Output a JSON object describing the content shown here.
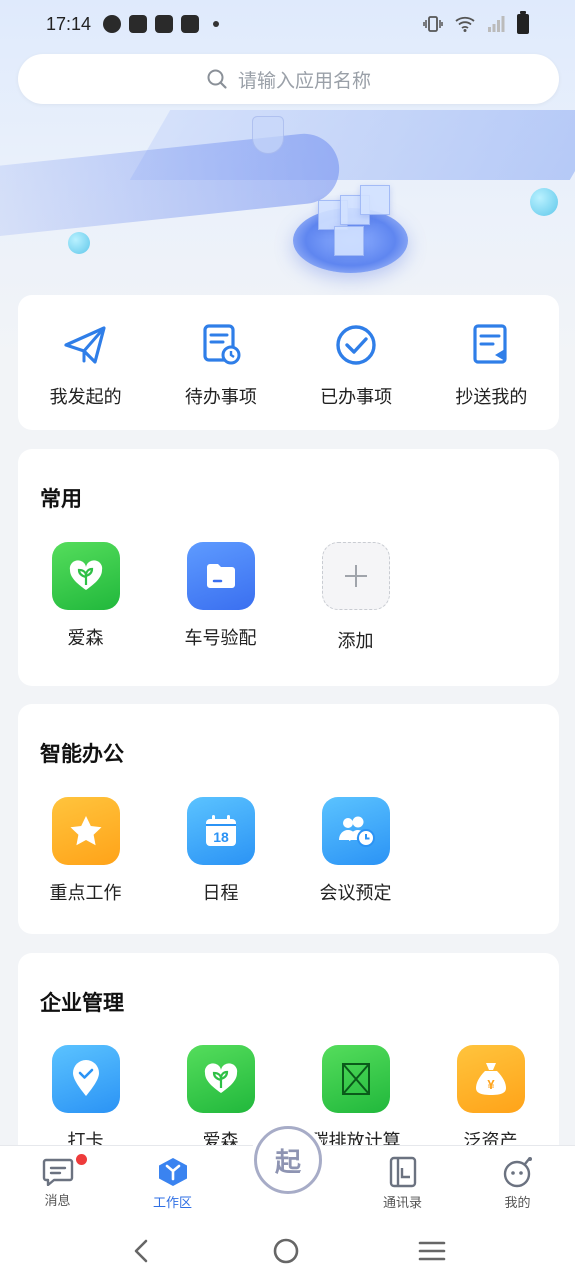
{
  "status_bar": {
    "time": "17:14"
  },
  "search": {
    "placeholder": "请输入应用名称"
  },
  "quick_actions": [
    {
      "label": "我发起的",
      "icon": "paper-plane-icon"
    },
    {
      "label": "待办事项",
      "icon": "todo-list-icon"
    },
    {
      "label": "已办事项",
      "icon": "check-circle-icon"
    },
    {
      "label": "抄送我的",
      "icon": "cc-document-icon"
    }
  ],
  "sections": {
    "common": {
      "title": "常用",
      "apps": [
        {
          "label": "爱森",
          "icon": "heart-leaf-icon"
        },
        {
          "label": "车号验配",
          "icon": "folder-icon"
        },
        {
          "label": "添加",
          "icon": "plus-icon"
        }
      ]
    },
    "smart_office": {
      "title": "智能办公",
      "apps": [
        {
          "label": "重点工作",
          "icon": "star-icon"
        },
        {
          "label": "日程",
          "icon": "calendar-icon",
          "calendar_day": "18"
        },
        {
          "label": "会议预定",
          "icon": "meeting-clock-icon"
        }
      ]
    },
    "enterprise": {
      "title": "企业管理",
      "apps": [
        {
          "label": "打卡",
          "icon": "location-check-icon"
        },
        {
          "label": "爱森",
          "icon": "heart-leaf-icon"
        },
        {
          "label": "碳排放计算",
          "icon": "image-placeholder-icon"
        },
        {
          "label": "泛资产",
          "icon": "money-bag-icon",
          "symbol": "¥"
        }
      ]
    }
  },
  "bottom_nav": {
    "items": [
      {
        "label": "消息",
        "icon": "message-icon"
      },
      {
        "label": "工作区",
        "icon": "workspace-cube-icon"
      },
      {
        "label": "通讯录",
        "icon": "contacts-icon"
      },
      {
        "label": "我的",
        "icon": "profile-face-icon"
      }
    ],
    "center_label": "起"
  },
  "colors": {
    "accent": "#2f6fe4",
    "badge": "#ee3b3b",
    "green": "#2fc046",
    "orange": "#ffae24"
  }
}
